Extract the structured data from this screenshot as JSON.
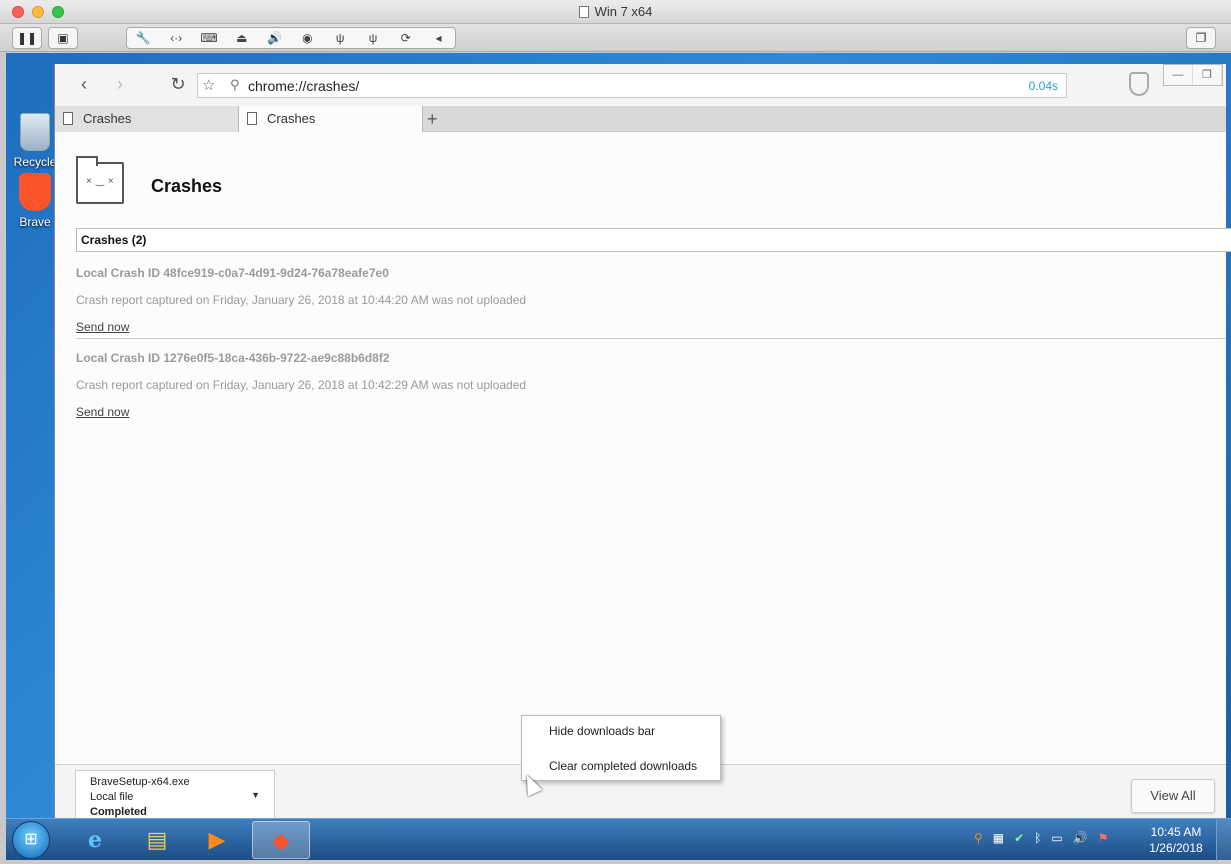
{
  "vm": {
    "title": "Win 7 x64",
    "pause_icon": "pause-icon",
    "toolbar_icons": [
      "wrench-icon",
      "network-icon",
      "keyboard-icon",
      "drive-icon",
      "sound-icon",
      "camera-icon",
      "usb-icon",
      "usb-icon",
      "sync-icon",
      "collapse-icon"
    ]
  },
  "desktop": {
    "recycle_label": "Recycle",
    "brave_label": "Brave"
  },
  "browser": {
    "url": "chrome://crashes/",
    "load_time": "0.04s",
    "tabs": [
      {
        "label": "Crashes"
      },
      {
        "label": "Crashes"
      }
    ],
    "new_tab": "+"
  },
  "page": {
    "title": "Crashes",
    "section_header": "Crashes (2)",
    "crashes": [
      {
        "id": "Local Crash ID 48fce919-c0a7-4d91-9d24-76a78eafe7e0",
        "desc": "Crash report captured on Friday, January 26, 2018 at 10:44:20 AM was not uploaded",
        "action": "Send now"
      },
      {
        "id": "Local Crash ID 1276e0f5-18ca-436b-9722-ae9c88b6d8f2",
        "desc": "Crash report captured on Friday, January 26, 2018 at 10:42:29 AM was not uploaded",
        "action": "Send now"
      }
    ]
  },
  "downloads": {
    "filename": "BraveSetup-x64.exe",
    "source": "Local file",
    "status": "Completed",
    "view_all": "View All"
  },
  "context_menu": {
    "items": [
      "Hide downloads bar",
      "Clear completed downloads"
    ]
  },
  "taskbar": {
    "time": "10:45 AM",
    "date": "1/26/2018"
  },
  "colors": {
    "accent": "#2a9fd8",
    "brave": "#fb542b",
    "crash_text": "#9a9a9a"
  }
}
